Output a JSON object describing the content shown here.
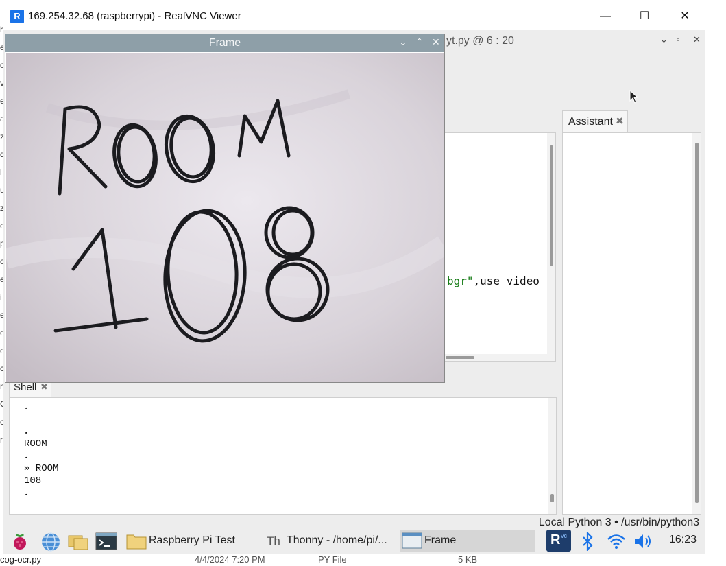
{
  "vnc": {
    "title": "169.254.32.68 (raspberrypi) - RealVNC Viewer",
    "minimize": "—",
    "maximize": "☐",
    "close": "✕"
  },
  "editor": {
    "file_label": "yt.py  @  6 : 20",
    "code_fragment_str": "bgr\"",
    "code_fragment_rest": ",use_video_"
  },
  "assistant": {
    "tab_label": "Assistant",
    "close": "✖"
  },
  "shell": {
    "tab_label": "Shell",
    "close": "✖",
    "lines": [
      "♩",
      "",
      "♩",
      "ROOM",
      "♩",
      "» ROOM",
      "108",
      "♩"
    ]
  },
  "status": {
    "interpreter": "Local Python 3  •  /usr/bin/python3"
  },
  "frame": {
    "title": "Frame",
    "image_text_line1": "ROOM",
    "image_text_line2": "108"
  },
  "taskbar": {
    "items": [
      {
        "label": "Raspberry Pi Test"
      },
      {
        "label": "Thonny  -  /home/pi/..."
      },
      {
        "label": "Frame"
      }
    ],
    "clock": "16:23"
  },
  "host": {
    "file_name": "cog-ocr.py",
    "file_date": "4/4/2024 7:20 PM",
    "file_type": "PY File",
    "file_size": "5 KB",
    "left_chars": [
      "h",
      "e",
      "o",
      "v",
      "e",
      "a",
      "z",
      "d",
      "l",
      "u",
      "z",
      "e",
      "p",
      "o",
      "e",
      "i",
      "e",
      "c",
      "o",
      "c",
      "n",
      "C",
      "c",
      "r"
    ]
  },
  "colors": {
    "vnc_accent": "#1a73e8",
    "frame_titlebar": "#8e9fa8",
    "code_string": "#147a14"
  }
}
